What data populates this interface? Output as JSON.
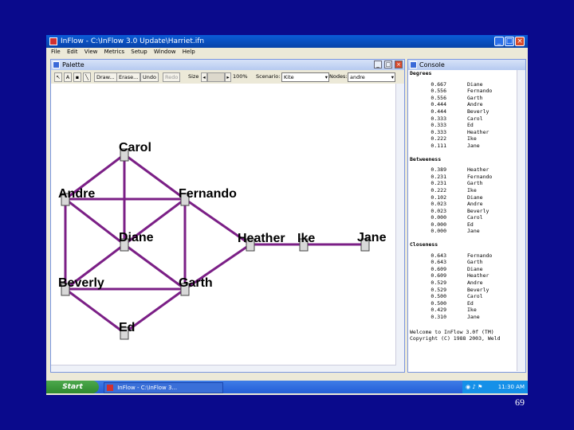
{
  "app": {
    "title": "InFlow - C:\\InFlow 3.0 Update\\Harriet.ifn",
    "menu": [
      "File",
      "Edit",
      "View",
      "Metrics",
      "Setup",
      "Window",
      "Help"
    ]
  },
  "palette": {
    "title": "Palette",
    "toolbar": {
      "draw": "Draw...",
      "erase": "Erase...",
      "undo": "Undo",
      "redo": "Redo",
      "size_label": "Size",
      "zoom": "100%",
      "scenario_label": "Scenario:",
      "scenario_value": "Kite",
      "nodes_label": "Nodes:",
      "nodes_value": "andre"
    },
    "nodes": [
      "Carol",
      "Andre",
      "Fernando",
      "Diane",
      "Heather",
      "Ike",
      "Jane",
      "Beverly",
      "Garth",
      "Ed"
    ]
  },
  "console": {
    "title": "Console",
    "sections": [
      {
        "heading": "Degrees",
        "rows": [
          [
            "0.667",
            "Diane"
          ],
          [
            "0.556",
            "Fernando"
          ],
          [
            "0.556",
            "Garth"
          ],
          [
            "0.444",
            "Andre"
          ],
          [
            "0.444",
            "Beverly"
          ],
          [
            "0.333",
            "Carol"
          ],
          [
            "0.333",
            "Ed"
          ],
          [
            "0.333",
            "Heather"
          ],
          [
            "0.222",
            "Ike"
          ],
          [
            "0.111",
            "Jane"
          ]
        ]
      },
      {
        "heading": "Betweeness",
        "rows": [
          [
            "0.389",
            "Heather"
          ],
          [
            "0.231",
            "Fernando"
          ],
          [
            "0.231",
            "Garth"
          ],
          [
            "0.222",
            "Ike"
          ],
          [
            "0.102",
            "Diane"
          ],
          [
            "0.023",
            "Andre"
          ],
          [
            "0.023",
            "Beverly"
          ],
          [
            "0.000",
            "Carol"
          ],
          [
            "0.000",
            "Ed"
          ],
          [
            "0.000",
            "Jane"
          ]
        ]
      },
      {
        "heading": "Closeness",
        "rows": [
          [
            "0.643",
            "Fernando"
          ],
          [
            "0.643",
            "Garth"
          ],
          [
            "0.609",
            "Diane"
          ],
          [
            "0.609",
            "Heather"
          ],
          [
            "0.529",
            "Andre"
          ],
          [
            "0.529",
            "Beverly"
          ],
          [
            "0.500",
            "Carol"
          ],
          [
            "0.500",
            "Ed"
          ],
          [
            "0.429",
            "Ike"
          ],
          [
            "0.310",
            "Jane"
          ]
        ]
      }
    ],
    "footer": [
      "Welcome to InFlow 3.0f (TM)",
      "Copyright (C) 1988 2003, Weld"
    ]
  },
  "taskbar": {
    "start": "Start",
    "task": "InFlow - C:\\InFlow 3...",
    "clock": "11:30 AM"
  },
  "slide_number": "69",
  "colors": {
    "edge": "#7b1f86",
    "desktop": "#0a0a8c"
  }
}
